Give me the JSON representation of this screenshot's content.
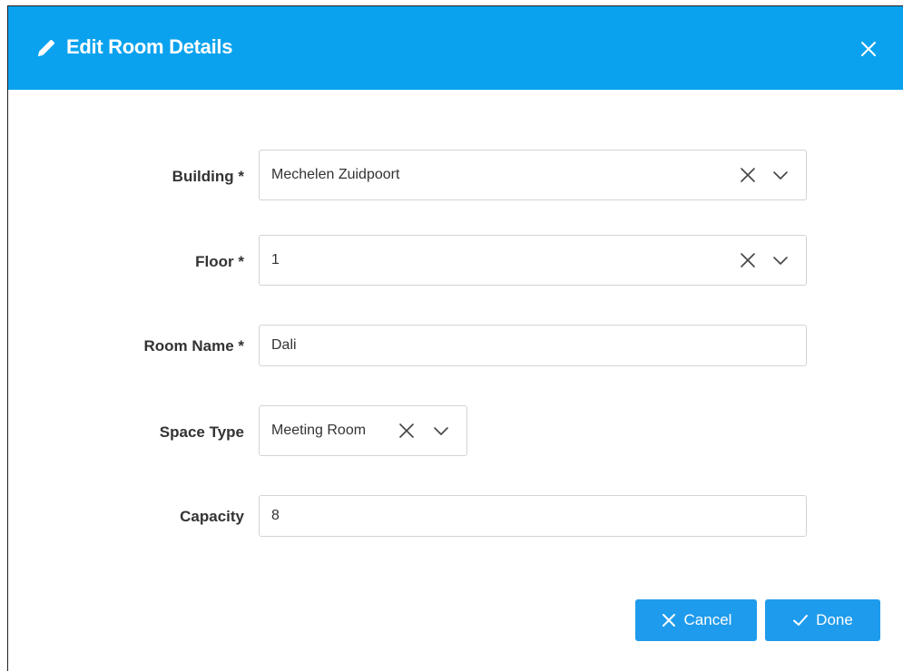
{
  "dialog": {
    "title": "Edit Room Details",
    "header_color": "#0aa2ee",
    "title_icon": "pencil-icon",
    "close_icon": "close-icon"
  },
  "form": {
    "building": {
      "label": "Building *",
      "value": "Mechelen Zuidpoort"
    },
    "floor": {
      "label": "Floor *",
      "value": "1"
    },
    "room_name": {
      "label": "Room Name *",
      "value": "Dali"
    },
    "space_type": {
      "label": "Space Type",
      "value": "Meeting Room"
    },
    "capacity": {
      "label": "Capacity",
      "value": "8"
    }
  },
  "actions": {
    "cancel_label": "Cancel",
    "done_label": "Done",
    "button_color": "#1e9bec"
  }
}
